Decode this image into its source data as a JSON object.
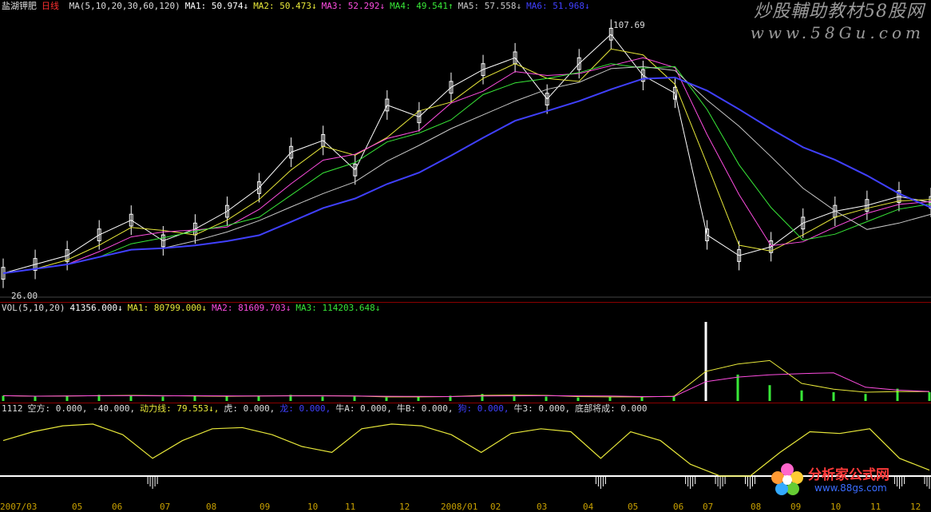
{
  "stock": {
    "name": "盐湖钾肥",
    "period": "日线"
  },
  "price_legend": [
    {
      "label": "MA(5,10,20,30,60,120)",
      "color": "#dddddd"
    },
    {
      "label": "MA1: 50.974↓",
      "color": "#ffffff"
    },
    {
      "label": "MA2: 50.473↓",
      "color": "#e8e83a"
    },
    {
      "label": "MA3: 52.292↓",
      "color": "#ff4de1"
    },
    {
      "label": "MA4: 49.541↑",
      "color": "#38e838"
    },
    {
      "label": "MA5: 57.558↓",
      "color": "#c8c8c8"
    },
    {
      "label": "MA6: 51.968↓",
      "color": "#4040ff"
    }
  ],
  "watermark_top": {
    "line1": "炒股輔助教材58股网",
    "line2": "www.58Gu.com"
  },
  "price_annotations": {
    "high": "107.69",
    "low": "26.00"
  },
  "vol_legend": [
    {
      "label": "VOL(5,10,20)",
      "color": "#dddddd"
    },
    {
      "label": "41356.000↓",
      "color": "#ffffff"
    },
    {
      "label": "MA1: 80799.000↓",
      "color": "#e8e83a"
    },
    {
      "label": "MA2: 81609.703↓",
      "color": "#ff4de1"
    },
    {
      "label": "MA3: 114203.648↓",
      "color": "#38e838"
    }
  ],
  "ind_legend": [
    {
      "label": "1112",
      "color": "#dddddd"
    },
    {
      "label": "空方: 0.000, -40.000,",
      "color": "#dddddd"
    },
    {
      "label": "动力线: 79.553↓,",
      "color": "#e8e83a"
    },
    {
      "label": "虎: 0.000,",
      "color": "#dddddd"
    },
    {
      "label": "龙: 0.000,",
      "color": "#4040ff"
    },
    {
      "label": "牛A: 0.000,",
      "color": "#dddddd"
    },
    {
      "label": "牛B: 0.000,",
      "color": "#dddddd"
    },
    {
      "label": "狗: 0.000,",
      "color": "#4040ff"
    },
    {
      "label": "牛3: 0.000,",
      "color": "#dddddd"
    },
    {
      "label": "底部将成: 0.000",
      "color": "#dddddd"
    }
  ],
  "date_ticks": [
    "2007/03",
    "05",
    "06",
    "07",
    "08",
    "09",
    "10",
    "11",
    "12",
    "2008/01",
    "02",
    "03",
    "04",
    "05",
    "06",
    "07",
    "08",
    "09",
    "10",
    "11",
    "12"
  ],
  "watermark_bottom": {
    "line1": "分析家公式网",
    "line2": "www.88gs.com"
  },
  "chart_data": {
    "type": "line",
    "title": "",
    "x": [
      "2007/03",
      "05",
      "06",
      "07",
      "08",
      "09",
      "10",
      "11",
      "12",
      "2008/01",
      "02",
      "03",
      "04",
      "05",
      "06",
      "07",
      "08",
      "09",
      "10",
      "11",
      "12"
    ],
    "price_high": 107.69,
    "price_low": 26.0,
    "close_series": [
      27,
      30,
      33,
      40,
      45,
      38,
      42,
      48,
      56,
      68,
      72,
      62,
      84,
      80,
      90,
      96,
      100,
      86,
      98,
      108,
      94,
      88,
      40,
      33,
      36,
      44,
      48,
      50,
      53,
      51
    ],
    "ma_series": [
      {
        "name": "MA1",
        "value": 50.974
      },
      {
        "name": "MA2",
        "value": 50.473
      },
      {
        "name": "MA3",
        "value": 52.292
      },
      {
        "name": "MA4",
        "value": 49.541
      },
      {
        "name": "MA5",
        "value": 57.558
      },
      {
        "name": "MA6",
        "value": 51.968
      }
    ],
    "volume_series": [
      6,
      5,
      6,
      7,
      6,
      5,
      6,
      5,
      6,
      7,
      5,
      5,
      4,
      5,
      6,
      8,
      6,
      5,
      4,
      5,
      5,
      6,
      90,
      30,
      18,
      12,
      10,
      8,
      14,
      10
    ],
    "power_line": [
      60,
      75,
      85,
      88,
      70,
      30,
      60,
      80,
      82,
      70,
      50,
      40,
      80,
      88,
      85,
      70,
      40,
      72,
      80,
      75,
      30,
      75,
      60,
      20,
      0,
      0,
      40,
      75,
      72,
      80,
      30,
      10
    ]
  }
}
